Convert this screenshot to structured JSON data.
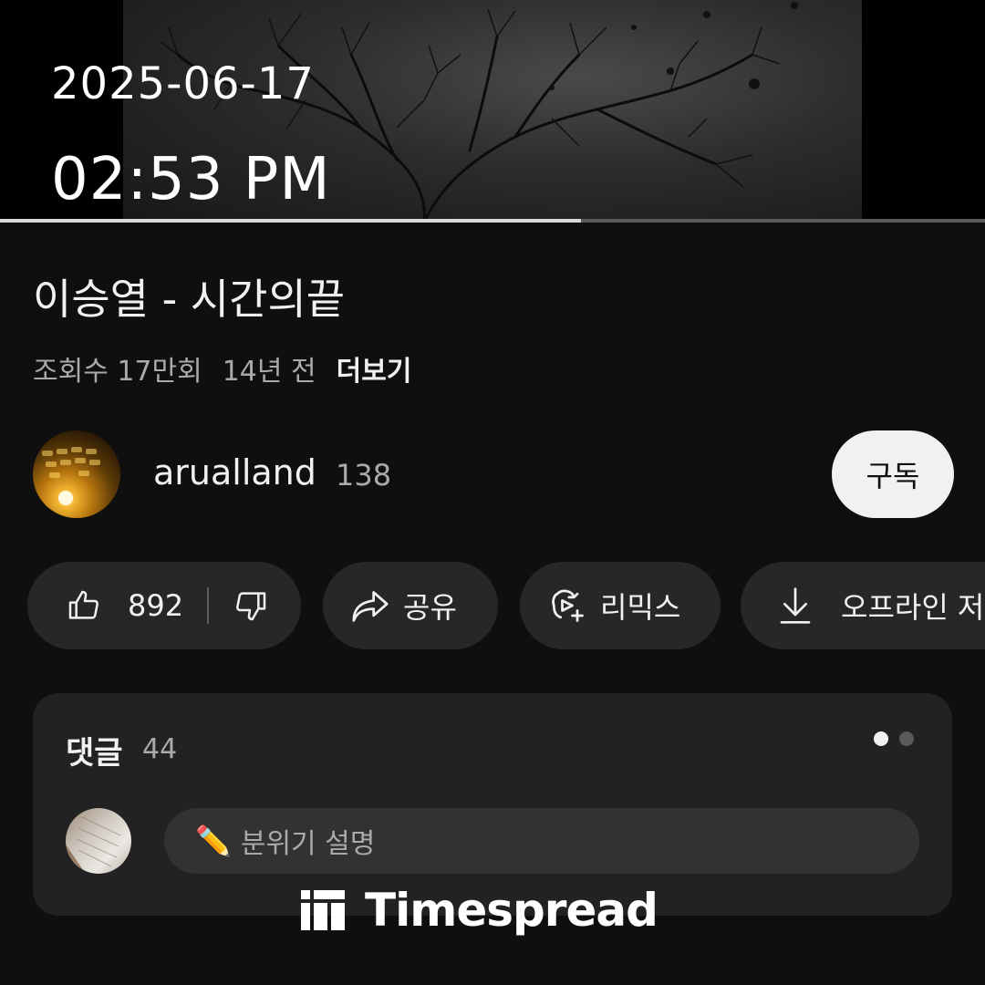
{
  "overlay": {
    "date": "2025-06-17",
    "time": "02:53 PM"
  },
  "player": {
    "progress_fraction": 0.59
  },
  "video": {
    "title": "이승열 - 시간의끝",
    "views": "조회수 17만회",
    "age": "14년 전",
    "more_label": "더보기"
  },
  "channel": {
    "name": "arualland",
    "subscriber_count": "138",
    "subscribe_label": "구독"
  },
  "actions": {
    "like_count": "892",
    "share_label": "공유",
    "remix_label": "리믹스",
    "download_label": "오프라인 저"
  },
  "comments": {
    "title": "댓글",
    "count": "44",
    "input_placeholder": "분위기 설명",
    "placeholder_icon": "✏️"
  },
  "watermark": {
    "text": "Timespread"
  },
  "icons": {
    "like": "thumbs-up-icon",
    "dislike": "thumbs-down-icon",
    "share": "share-arrow-icon",
    "remix": "remix-icon",
    "download": "download-icon"
  },
  "colors": {
    "background": "#0f0f0f",
    "pill": "#272727",
    "subscribe_bg": "#f1f1f1",
    "secondary_text": "#aaaaaa"
  }
}
